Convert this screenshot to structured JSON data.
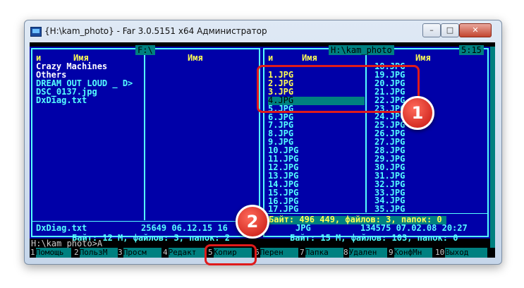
{
  "window": {
    "title": "{H:\\kam_photo} - Far 3.0.5151 x64 Администратор",
    "min": "–",
    "max": "□",
    "close": "✕"
  },
  "left_panel": {
    "path": "F:\\",
    "col1_marker": "и",
    "col1_header": "Имя",
    "col2_header": "Имя",
    "files": [
      "Crazy Machines",
      "Others",
      "DREAM OUT LOUD _ D>",
      "DSC_0137.jpg",
      "DxDiag.txt"
    ],
    "selected_name": "DxDiag.txt",
    "selected_info": "25649 06.12.15 16",
    "summary": "Байт: 12 М, файлов: 3, папок: 2"
  },
  "right_panel": {
    "path": "H:\\kam_photo",
    "clock": "5:15",
    "col1_marker": "и",
    "col1_header": "Имя",
    "col2_header": "Имя",
    "col1_files": [
      "1.JPG",
      "2.JPG",
      "3.JPG",
      "4.JPG",
      "5.JPG",
      "6.JPG",
      "7.JPG",
      "8.JPG",
      "9.JPG",
      "10.JPG",
      "11.JPG",
      "12.JPG",
      "13.JPG",
      "14.JPG",
      "15.JPG",
      "16.JPG",
      "17.JPG"
    ],
    "col2_files": [
      "18.JPG",
      "19.JPG",
      "20.JPG",
      "21.JPG",
      "22.JPG",
      "23.JPG",
      "24.JPG",
      "25.JPG",
      "26.JPG",
      "27.JPG",
      "28.JPG",
      "29.JPG",
      "30.JPG",
      "31.JPG",
      "32.JPG",
      "33.JPG",
      "34.JPG",
      "35.JPG"
    ],
    "selection_summary": "Байт: 496 449, файлов: 3, папок: 0",
    "selected_name": "JPG",
    "selected_info": "134575 07.02.08 20:27",
    "summary": "Байт: 15 М, файлов: 103, папок: 0"
  },
  "command_line": "H:\\kam_photo>A",
  "keybar": [
    {
      "n": "1",
      "label": "Помощь"
    },
    {
      "n": "2",
      "label": "ПользМ"
    },
    {
      "n": "3",
      "label": "Просм"
    },
    {
      "n": "4",
      "label": "Редакт"
    },
    {
      "n": "5",
      "label": "Копир"
    },
    {
      "n": "6",
      "label": "Перен"
    },
    {
      "n": "7",
      "label": "Папка"
    },
    {
      "n": "8",
      "label": "Удален"
    },
    {
      "n": "9",
      "label": "КонфМн"
    },
    {
      "n": "10",
      "label": "Выход"
    }
  ],
  "annotations": {
    "badge1": "1",
    "badge2": "2"
  },
  "colors": {
    "panel_bg": "#0000a8",
    "frame": "#55ffff",
    "selected": "#008080",
    "marked": "#ffff55",
    "annotation": "#e01b1b"
  }
}
